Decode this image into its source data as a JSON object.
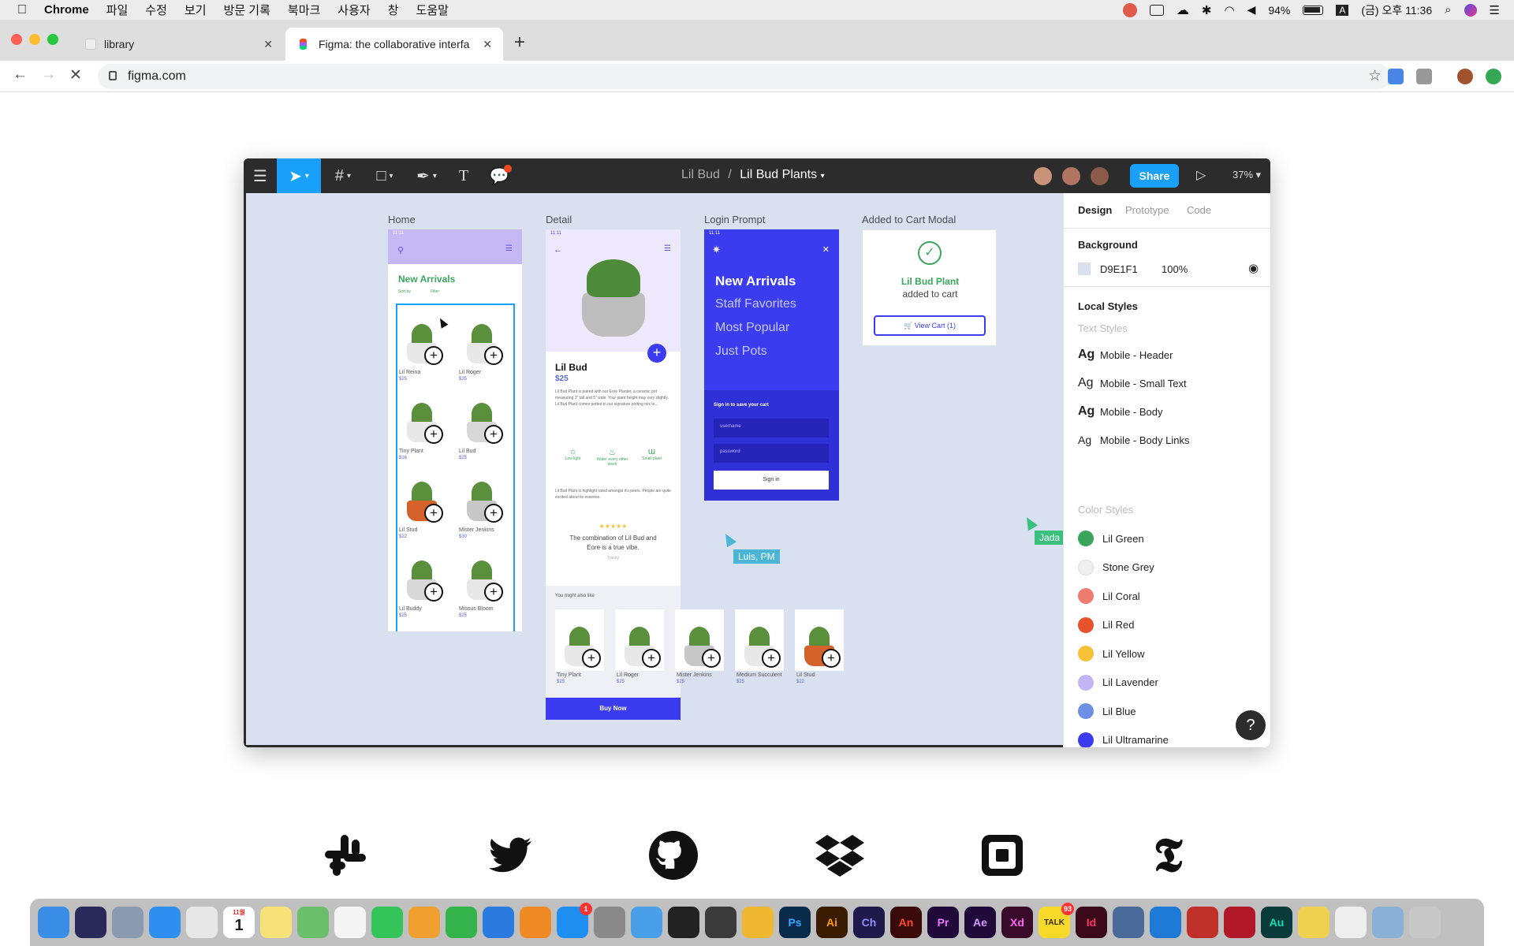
{
  "menubar": {
    "app": "Chrome",
    "items": [
      "파일",
      "수정",
      "보기",
      "방문 기록",
      "북마크",
      "사용자",
      "창",
      "도움말"
    ],
    "battery": "94%",
    "input_source": "A",
    "datetime": "(금) 오후 11:36"
  },
  "browser": {
    "tabs": [
      {
        "label": "library"
      },
      {
        "label": "Figma: the collaborative interfa"
      }
    ],
    "url": "figma.com"
  },
  "figma": {
    "breadcrumb_team": "Lil Bud",
    "breadcrumb_sep": "/",
    "breadcrumb_file": "Lil Bud Plants",
    "share_label": "Share",
    "zoom": "37%",
    "frames": {
      "home": {
        "label": "Home",
        "status_time": "11:11",
        "title": "New Arrivals",
        "sort": "Sort by",
        "filter": "Filter",
        "products": [
          {
            "name": "Lil Reina",
            "price": "$25"
          },
          {
            "name": "Lil Roger",
            "price": "$35"
          },
          {
            "name": "Tiny Plant",
            "price": "$16"
          },
          {
            "name": "Lil Bud",
            "price": "$25"
          },
          {
            "name": "Lil Stud",
            "price": "$22"
          },
          {
            "name": "Mister Jenkins",
            "price": "$30"
          },
          {
            "name": "Lil Buddy",
            "price": "$25"
          },
          {
            "name": "Missus Bloom",
            "price": "$25"
          }
        ]
      },
      "detail": {
        "label": "Detail",
        "status_time": "11:11",
        "name": "Lil Bud",
        "price": "$25",
        "desc": "Lil Bud Plant is paired with our Eore Planter, a ceramic pot measuring 3\" tall and 5\" wide. Your plant height may vary slightly. Lil Bud Plant comes potted in our signature potting mix to...",
        "features": [
          "Low light",
          "Water every other week",
          "Small plant"
        ],
        "review_intro": "Lil Bud Plant is highlight rated amongst it's peers. People are quite excited about its essence.",
        "stars": "★★★★★",
        "quote": "The combination of Lil Bud and Eore is a true vibe.",
        "reviewer": "Tracey",
        "also_like": "You might also like",
        "related": [
          {
            "name": "Tiny Plant",
            "price": "$25"
          },
          {
            "name": "Lil Roger",
            "price": "$25"
          },
          {
            "name": "Mister Jenkins",
            "price": "$25"
          },
          {
            "name": "Medium Succulent",
            "price": "$25"
          },
          {
            "name": "Lil Stud",
            "price": "$22"
          }
        ],
        "buy_label": "Buy Now"
      },
      "login": {
        "label": "Login Prompt",
        "status_time": "11:11",
        "menu": [
          "New Arrivals",
          "Staff Favorites",
          "Most Popular",
          "Just Pots"
        ],
        "signin_title": "Sign in to save your cart",
        "username_placeholder": "username",
        "password_placeholder": "password",
        "signin_label": "Sign in"
      },
      "modal": {
        "label": "Added to Cart Modal",
        "product": "Lil Bud Plant",
        "message": "added to cart",
        "button": "View Cart (1)"
      }
    },
    "cursors": [
      {
        "name": "Luis, PM",
        "color": "#4bb5d6"
      },
      {
        "name": "Jada",
        "color": "#39c07f"
      }
    ],
    "panel": {
      "tabs": [
        "Design",
        "Prototype",
        "Code"
      ],
      "background_title": "Background",
      "bg_hex": "D9E1F1",
      "bg_opacity": "100%",
      "local_styles": "Local Styles",
      "text_styles_title": "Text Styles",
      "text_styles": [
        "Mobile - Header",
        "Mobile - Small Text",
        "Mobile - Body",
        "Mobile - Body Links"
      ],
      "ag": "Ag",
      "color_styles_title": "Color Styles",
      "color_styles": [
        {
          "name": "Lil Green",
          "color": "#3aa55b"
        },
        {
          "name": "Stone Grey",
          "color": "#efefef"
        },
        {
          "name": "Lil Coral",
          "color": "#f07b6f"
        },
        {
          "name": "Lil Red",
          "color": "#e8522a"
        },
        {
          "name": "Lil Yellow",
          "color": "#f7c23a"
        },
        {
          "name": "Lil Lavender",
          "color": "#c3b4f5"
        },
        {
          "name": "Lil Blue",
          "color": "#6d8fe6"
        },
        {
          "name": "Lil Ultramarine",
          "color": "#3b3cf0"
        }
      ],
      "help": "?"
    }
  },
  "dock": {
    "apps": [
      "Finder",
      "Siri",
      "Launchpad",
      "Safari",
      "Chrome",
      "Calendar",
      "Notes",
      "Maps",
      "Photos",
      "FaceTime",
      "Pages",
      "Numbers",
      "Keynote",
      "Books",
      "App Store",
      "System Preferences",
      "Xcode",
      "Terminal",
      "Sync",
      "Sketch",
      "Ps",
      "Ai",
      "Ch",
      "An",
      "Pr",
      "Ae",
      "Xd",
      "TALK",
      "Id",
      "Capture",
      "VS Code",
      "FileZilla",
      "Mendeley",
      "Au",
      "Stickies",
      "TextEdit",
      "Preview",
      "Trash"
    ],
    "calendar_month": "11월",
    "calendar_day": "1",
    "badge_appstore": "1",
    "badge_talk": "93"
  }
}
